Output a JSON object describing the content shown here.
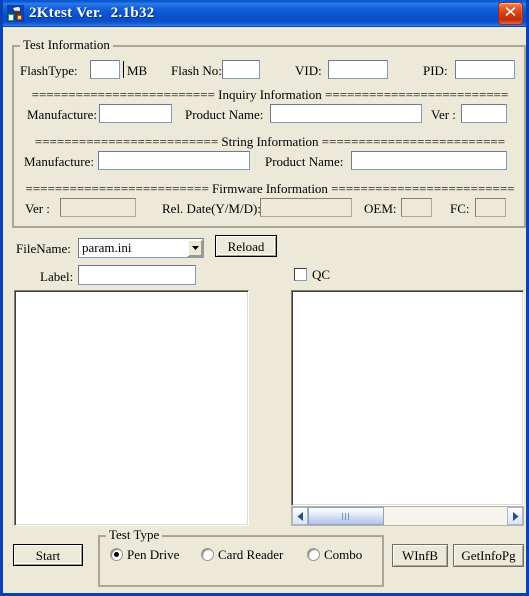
{
  "window": {
    "title": "2Ktest Ver.  2.1b32",
    "icon": "app-icon",
    "close_label": "×"
  },
  "test_information": {
    "legend": "Test Information",
    "flash_type": {
      "label": "FlashType:",
      "value": "",
      "unit": "MB"
    },
    "flash_no": {
      "label": "Flash No:",
      "value": ""
    },
    "vid": {
      "label": "VID:",
      "value": ""
    },
    "pid": {
      "label": "PID:",
      "value": ""
    },
    "inquiry": {
      "separator": "========================= Inquiry Information =========================",
      "manufacture": {
        "label": "Manufacture:",
        "value": ""
      },
      "product_name": {
        "label": "Product Name:",
        "value": ""
      },
      "ver": {
        "label": "Ver :",
        "value": ""
      }
    },
    "string": {
      "separator": "========================= String Information =========================",
      "manufacture": {
        "label": "Manufacture:",
        "value": ""
      },
      "product_name": {
        "label": "Product Name:",
        "value": ""
      }
    },
    "firmware": {
      "separator": "========================= Firmware Information =========================",
      "ver": {
        "label": "Ver :",
        "value": ""
      },
      "rel_date": {
        "label": "Rel. Date(Y/M/D):",
        "value": ""
      },
      "oem": {
        "label": "OEM:",
        "value": ""
      },
      "fc": {
        "label": "FC:",
        "value": ""
      }
    }
  },
  "file_section": {
    "filename_label": "FileName:",
    "filename_value": "param.ini",
    "filename_options": [
      "param.ini"
    ],
    "reload_label": "Reload",
    "label_label": "Label:",
    "label_value": "",
    "qc_label": "QC",
    "qc_checked": false
  },
  "panels": {
    "left_log": "",
    "right_log": ""
  },
  "scrollbar": {
    "left_arrow": "◀",
    "right_arrow": "▶"
  },
  "footer": {
    "start_label": "Start",
    "test_type": {
      "legend": "Test Type",
      "options": [
        {
          "label": "Pen Drive",
          "selected": true
        },
        {
          "label": "Card Reader",
          "selected": false
        },
        {
          "label": "Combo",
          "selected": false
        }
      ]
    },
    "winfb_label": "WInfB",
    "getinfopg_label": "GetInfoPg"
  },
  "colors": {
    "window_face": "#ece9d8",
    "title_blue": "#0a51cf",
    "border_blue": "#0a3fb5",
    "close_red": "#cf3a10"
  }
}
